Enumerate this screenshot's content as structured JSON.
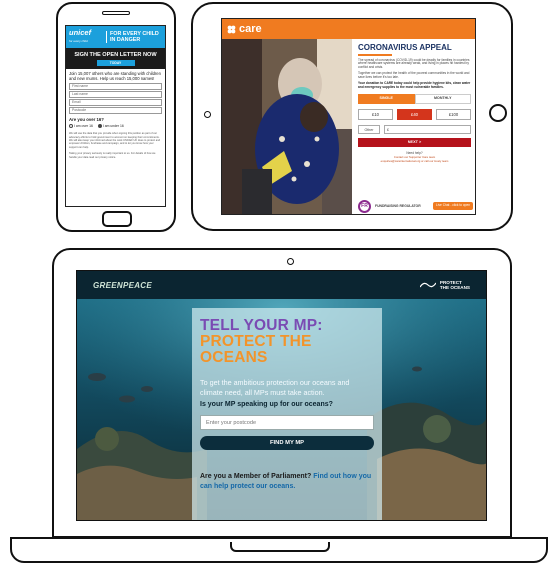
{
  "phone": {
    "unicef_logo": "unicef",
    "unicef_sub": "for every child",
    "tagline_1": "FOR EVERY CHILD",
    "tagline_2": "IN DANGER",
    "band_title": "SIGN THE OPEN LETTER NOW",
    "band_button": "TODAY",
    "intro": "Join 15,007 others who are standing with children and new mums. Help us reach 15,000 names!",
    "fields": [
      "First name",
      "Last name",
      "Email",
      "Postcode"
    ],
    "age_question": "Are you over 16?",
    "age_options": [
      "I am over 16",
      "I am under 16"
    ],
    "fine_print": "We will use the data that you provide when signing this petition as part of our advocacy efforts to hold government to account on keeping their commitments. We will also keep you informed about the work UNICEF UK does to protect and empower children, fundraise and campaign, and to let you know how your support can help.",
    "fine_print_2": "Taking your privacy seriously is really important to us. For details of how we handle your data read our privacy notice."
  },
  "tablet": {
    "brand": "care",
    "title": "CORONAVIRUS APPEAL",
    "para1": "The spread of coronavirus (COVID-19) could be deadly for families in countries where healthcare systems are already weak, and living in places hit hardest by conflict and crisis.",
    "para2": "Together we can protect the health of the poorest communities in the world and save lives before it's too late.",
    "para3": "Your donation to CARE today could help provide hygiene kits, clean water and emergency supplies to the most vulnerable families.",
    "tabs": [
      "SINGLE",
      "MONTHLY"
    ],
    "amounts": [
      "£10",
      "£40",
      "£100"
    ],
    "other_label": "Other",
    "other_value": "£",
    "next_button": "NEXT >",
    "help_text": "Need help?",
    "contact_text": "Contact our Supporter Care team",
    "contact_email": "enquiries@careinternational.org or call our lovely team",
    "regulator": "FUNDRAISING REGULATOR",
    "regulator_mark": "FR",
    "live_chat": "Live Chat - click to open"
  },
  "laptop": {
    "brand": "GREENPEACE",
    "campaign_logo_1": "PROTECT",
    "campaign_logo_2": "THE OCEANS",
    "title_line1": "TELL YOUR MP:",
    "title_line2": "PROTECT THE OCEANS",
    "lead": "To get the ambitious protection our oceans and climate need, all MPs must take action.",
    "question": "Is your MP speaking up for our oceans?",
    "postcode_placeholder": "Enter your postcode",
    "cta": "FIND MY MP",
    "mp_text": "Are you a Member of Parliament?",
    "mp_link": "Find out how you can help protect our oceans."
  },
  "colors": {
    "unicef_blue": "#1ca0dc",
    "care_orange": "#f07b20",
    "care_red": "#b5121b",
    "gp_navy": "#0b2531",
    "gp_purple": "#7a4bb3",
    "gp_orange": "#f2942b"
  }
}
